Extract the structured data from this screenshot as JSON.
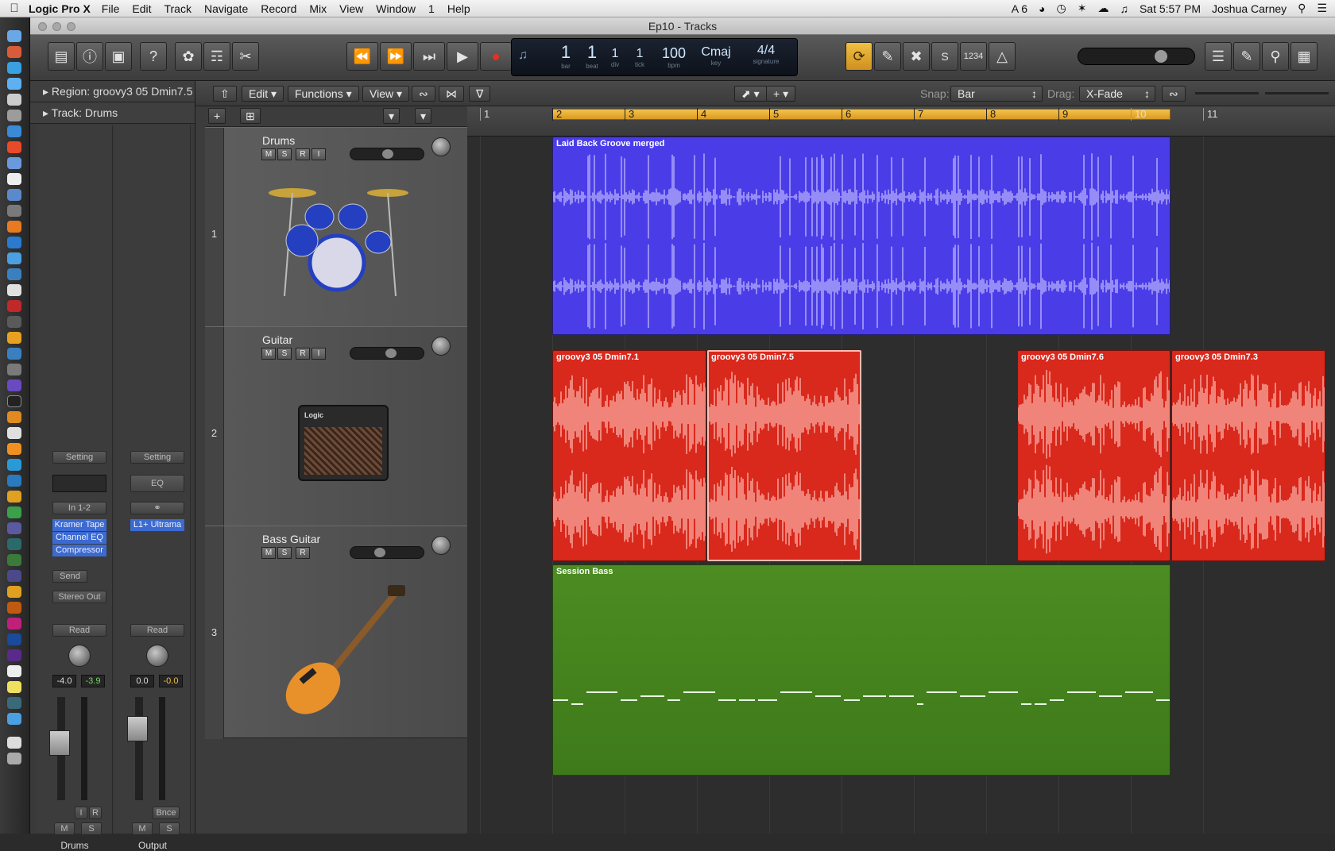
{
  "menubar": {
    "app": "Logic Pro X",
    "items": [
      "File",
      "Edit",
      "Track",
      "Navigate",
      "Record",
      "Mix",
      "View",
      "Window",
      "1",
      "Help"
    ],
    "status_count": "6",
    "time": "Sat 5:57 PM",
    "user": "Joshua Carney"
  },
  "window": {
    "title": "Ep10 - Tracks"
  },
  "lcd": {
    "bar": "1",
    "beat": "1",
    "div": "1",
    "tick": "1",
    "tempo": "100",
    "key": "Cmaj",
    "sig": "4/4",
    "lbl_bar": "bar",
    "lbl_beat": "beat",
    "lbl_div": "div",
    "lbl_tick": "tick",
    "lbl_bpm": "bpm",
    "lbl_key": "key",
    "lbl_sig": "signature"
  },
  "toolbar": {
    "count_in": "1234"
  },
  "inspector": {
    "region": "Region: groovy3 05 Dmin7.5",
    "track": "Track: Drums"
  },
  "strip1": {
    "setting": "Setting",
    "input": "In 1-2",
    "plugins": [
      "Kramer Tape",
      "Channel EQ",
      "Compressor"
    ],
    "send": "Send",
    "output": "Stereo Out",
    "auto": "Read",
    "vol": "-4.0",
    "peak": "-3.9",
    "m": "M",
    "s": "S",
    "i": "I",
    "r": "R",
    "name": "Drums"
  },
  "strip2": {
    "setting": "Setting",
    "eq": "EQ",
    "plugins": [
      "L1+ Ultrama"
    ],
    "auto": "Read",
    "vol": "0.0",
    "peak": "-0.0",
    "bnce": "Bnce",
    "m": "M",
    "s": "S",
    "name": "Output"
  },
  "editbar": {
    "edit": "Edit",
    "functions": "Functions",
    "view": "View",
    "snap_label": "Snap:",
    "snap": "Bar",
    "drag_label": "Drag:",
    "drag": "X-Fade"
  },
  "tracks": [
    {
      "num": "1",
      "name": "Drums"
    },
    {
      "num": "2",
      "name": "Guitar"
    },
    {
      "num": "3",
      "name": "Bass Guitar"
    }
  ],
  "track_buttons": {
    "m": "M",
    "s": "S",
    "r": "R",
    "i": "I"
  },
  "amp_brand": "Logic",
  "ruler": [
    "1",
    "2",
    "3",
    "4",
    "5",
    "6",
    "7",
    "8",
    "9",
    "10",
    "11"
  ],
  "regions": {
    "drums": "Laid Back Groove merged",
    "g1": "groovy3 05 Dmin7.1",
    "g2": "groovy3 05 Dmin7.5",
    "g3": "groovy3 05 Dmin7.6",
    "g4": "groovy3 05 Dmin7.3",
    "bass": "Session Bass"
  },
  "colors": {
    "drums": "#4a3de8",
    "guitar": "#d9281c",
    "bass": "#4c8c22",
    "cycle": "#e7ad33"
  }
}
